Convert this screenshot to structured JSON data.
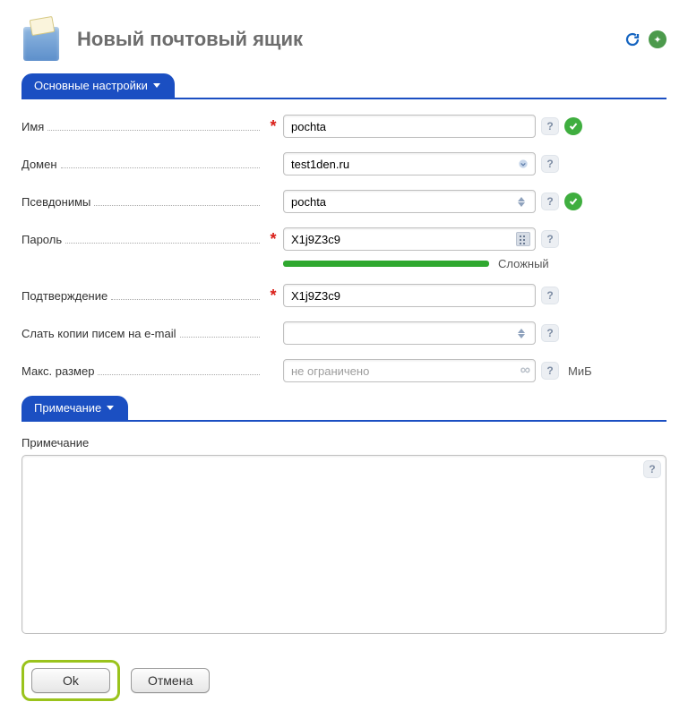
{
  "page_title": "Новый почтовый ящик",
  "sections": {
    "main": "Основные настройки",
    "note": "Примечание"
  },
  "labels": {
    "name": "Имя",
    "domain": "Домен",
    "aliases": "Псевдонимы",
    "password": "Пароль",
    "confirm": "Подтверждение",
    "copies": "Слать копии писем на e-mail",
    "maxsize": "Макс. размер",
    "note": "Примечание"
  },
  "values": {
    "name": "pochta",
    "domain": "test1den.ru",
    "aliases": "pochta",
    "password": "X1j9Z3c9",
    "confirm": "X1j9Z3c9",
    "copies": "",
    "maxsize": ""
  },
  "placeholders": {
    "maxsize": "не ограничено"
  },
  "password_strength": "Сложный",
  "units": {
    "maxsize": "МиБ"
  },
  "buttons": {
    "ok": "Ok",
    "cancel": "Отмена"
  }
}
